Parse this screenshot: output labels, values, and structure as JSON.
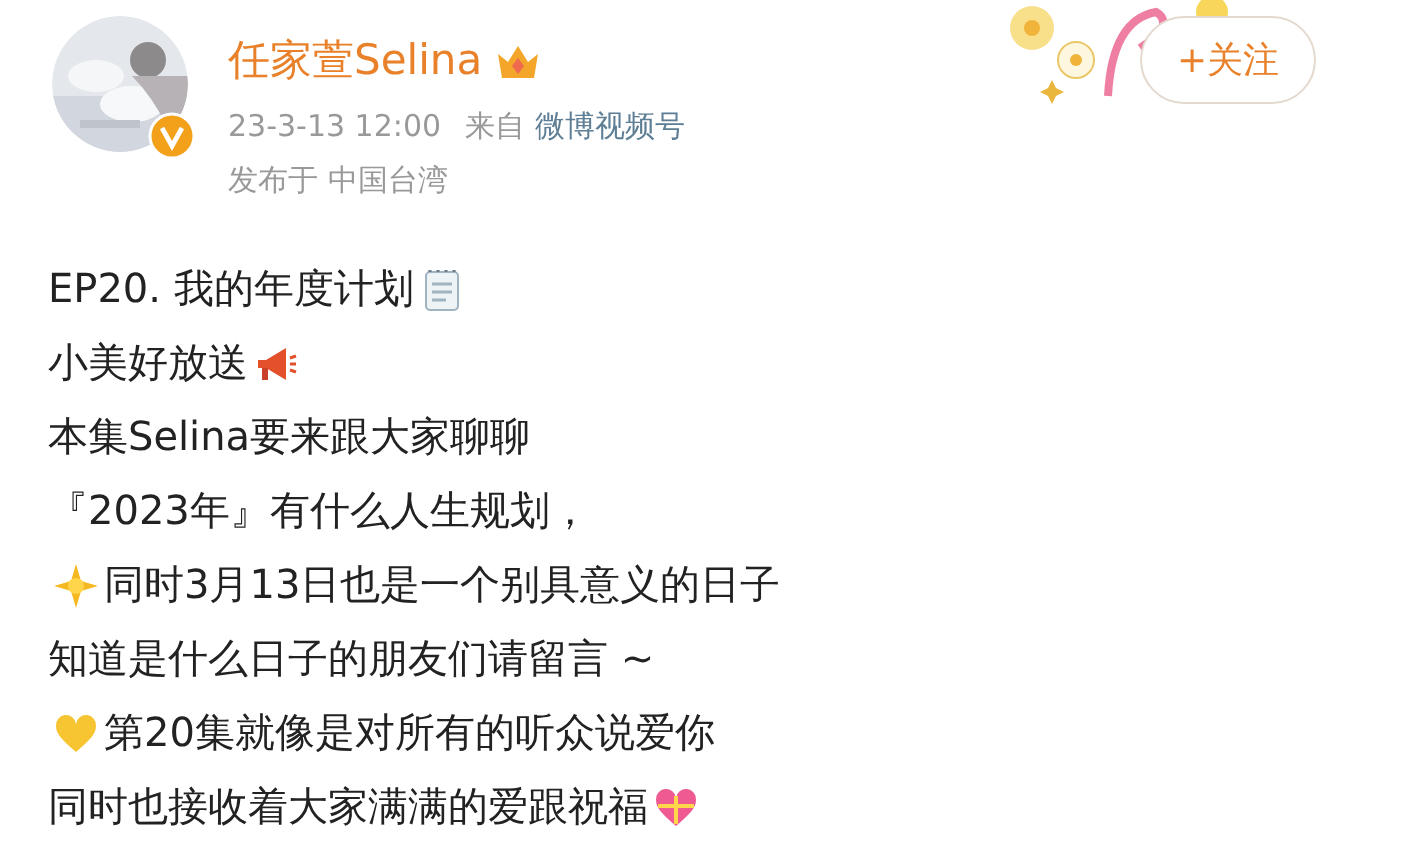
{
  "author": {
    "name": "任家萱Selina",
    "verified": true
  },
  "meta": {
    "time": "23-3-13 12:00",
    "source_prefix": "来自",
    "source": "微博视频号",
    "location": "发布于 中国台湾"
  },
  "follow_button": {
    "label": "+关注"
  },
  "post": {
    "lines": [
      "EP20. 我的年度计划",
      "小美好放送",
      "本集Selina要来跟大家聊聊",
      "『2023年』有什么人生规划，",
      "同时3月13日也是一个别具意义的日子",
      "知道是什么日子的朋友们请留言 ~",
      "第20集就像是对所有的听众说爱你",
      "同时也接收着大家满满的爱跟祝福"
    ]
  }
}
